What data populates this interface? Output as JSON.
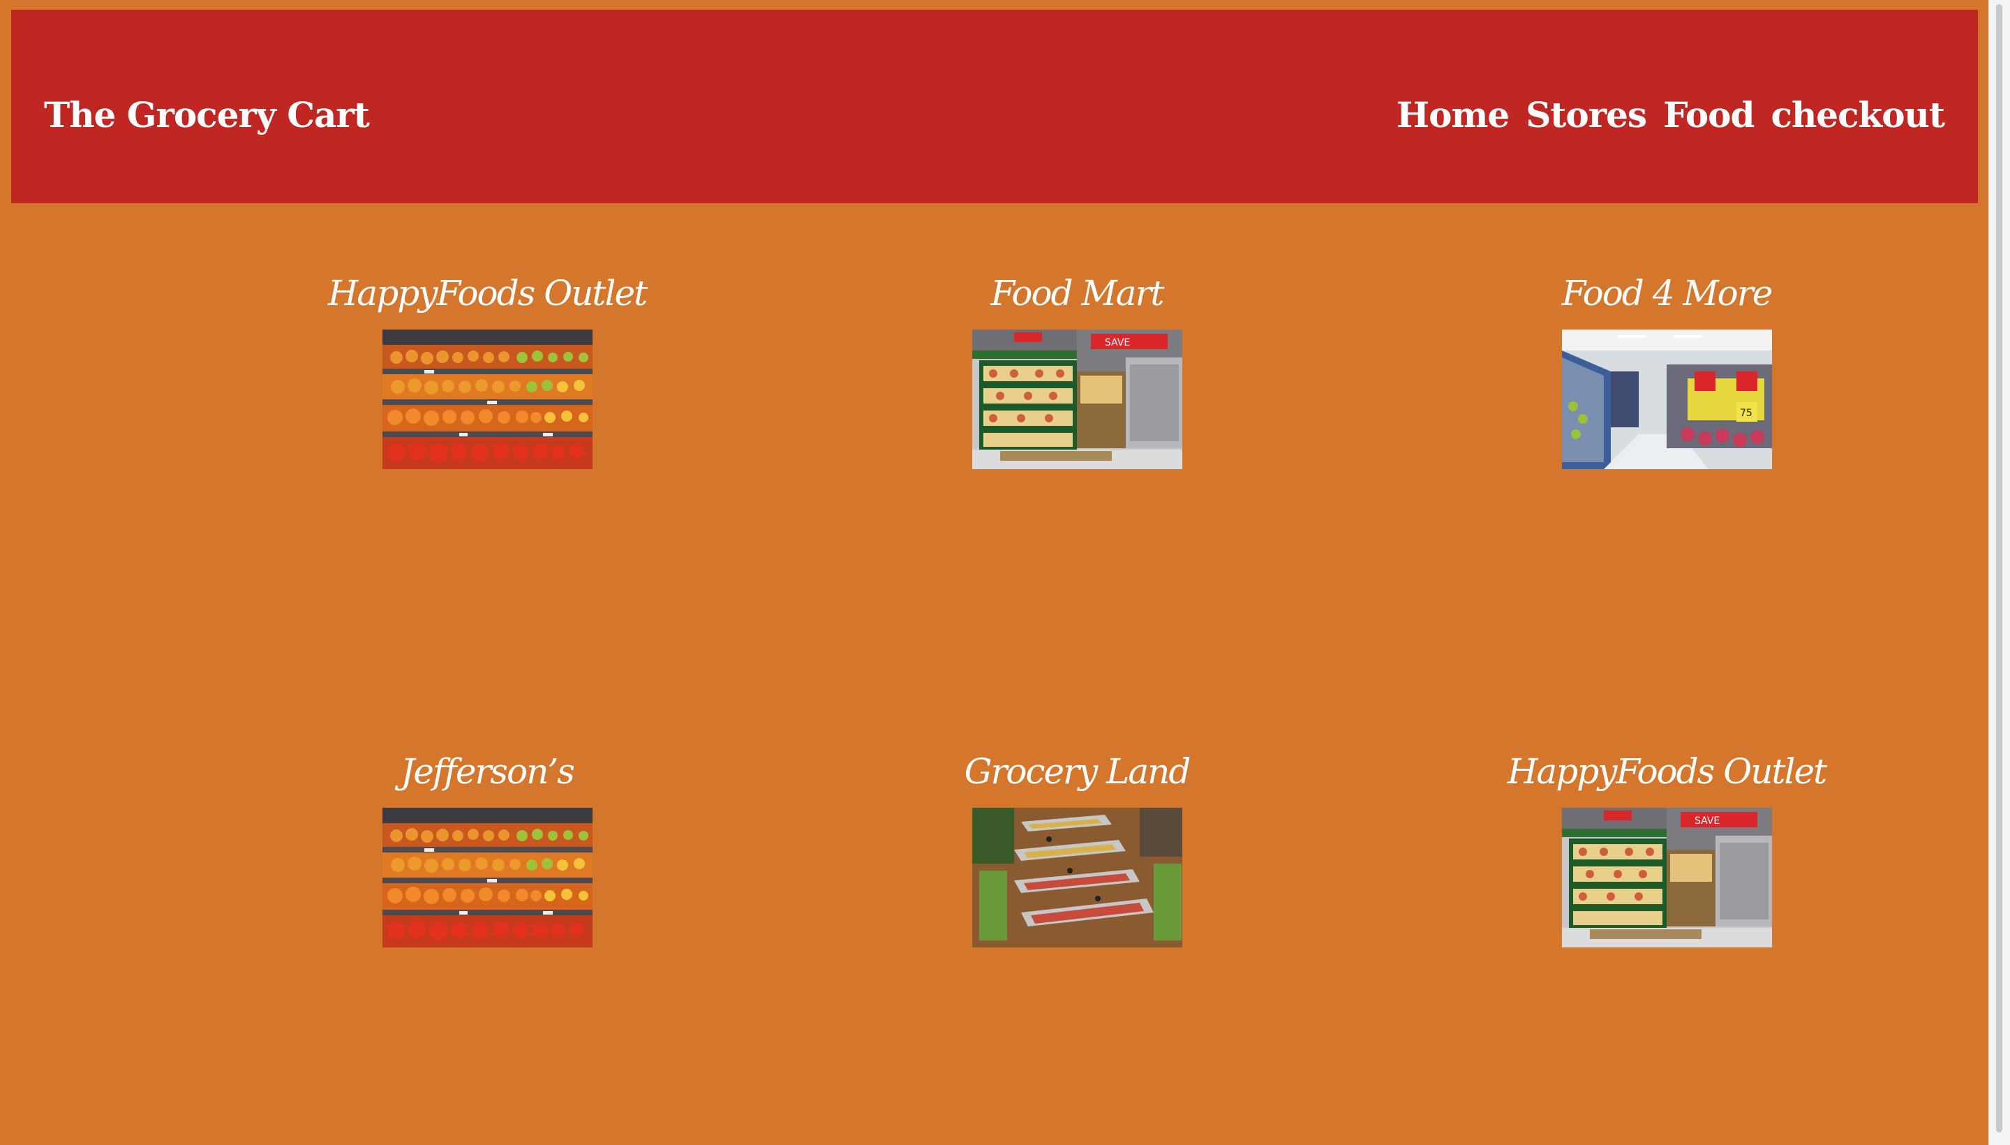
{
  "header": {
    "brand": "The Grocery Cart",
    "nav": [
      "Home",
      "Stores",
      "Food",
      "checkout"
    ]
  },
  "stores": [
    {
      "name": "HappyFoods Outlet",
      "image": "produce-shelves"
    },
    {
      "name": "Food Mart",
      "image": "store-aisle-sale"
    },
    {
      "name": "Food 4 More",
      "image": "store-aisle-wide"
    },
    {
      "name": "Jefferson’s",
      "image": "produce-shelves"
    },
    {
      "name": "Grocery Land",
      "image": "store-overhead"
    },
    {
      "name": "HappyFoods Outlet",
      "image": "store-aisle-sale"
    }
  ],
  "colors": {
    "page_background": "#d4772c",
    "header_background": "#c02622",
    "text": "#ffffff"
  }
}
